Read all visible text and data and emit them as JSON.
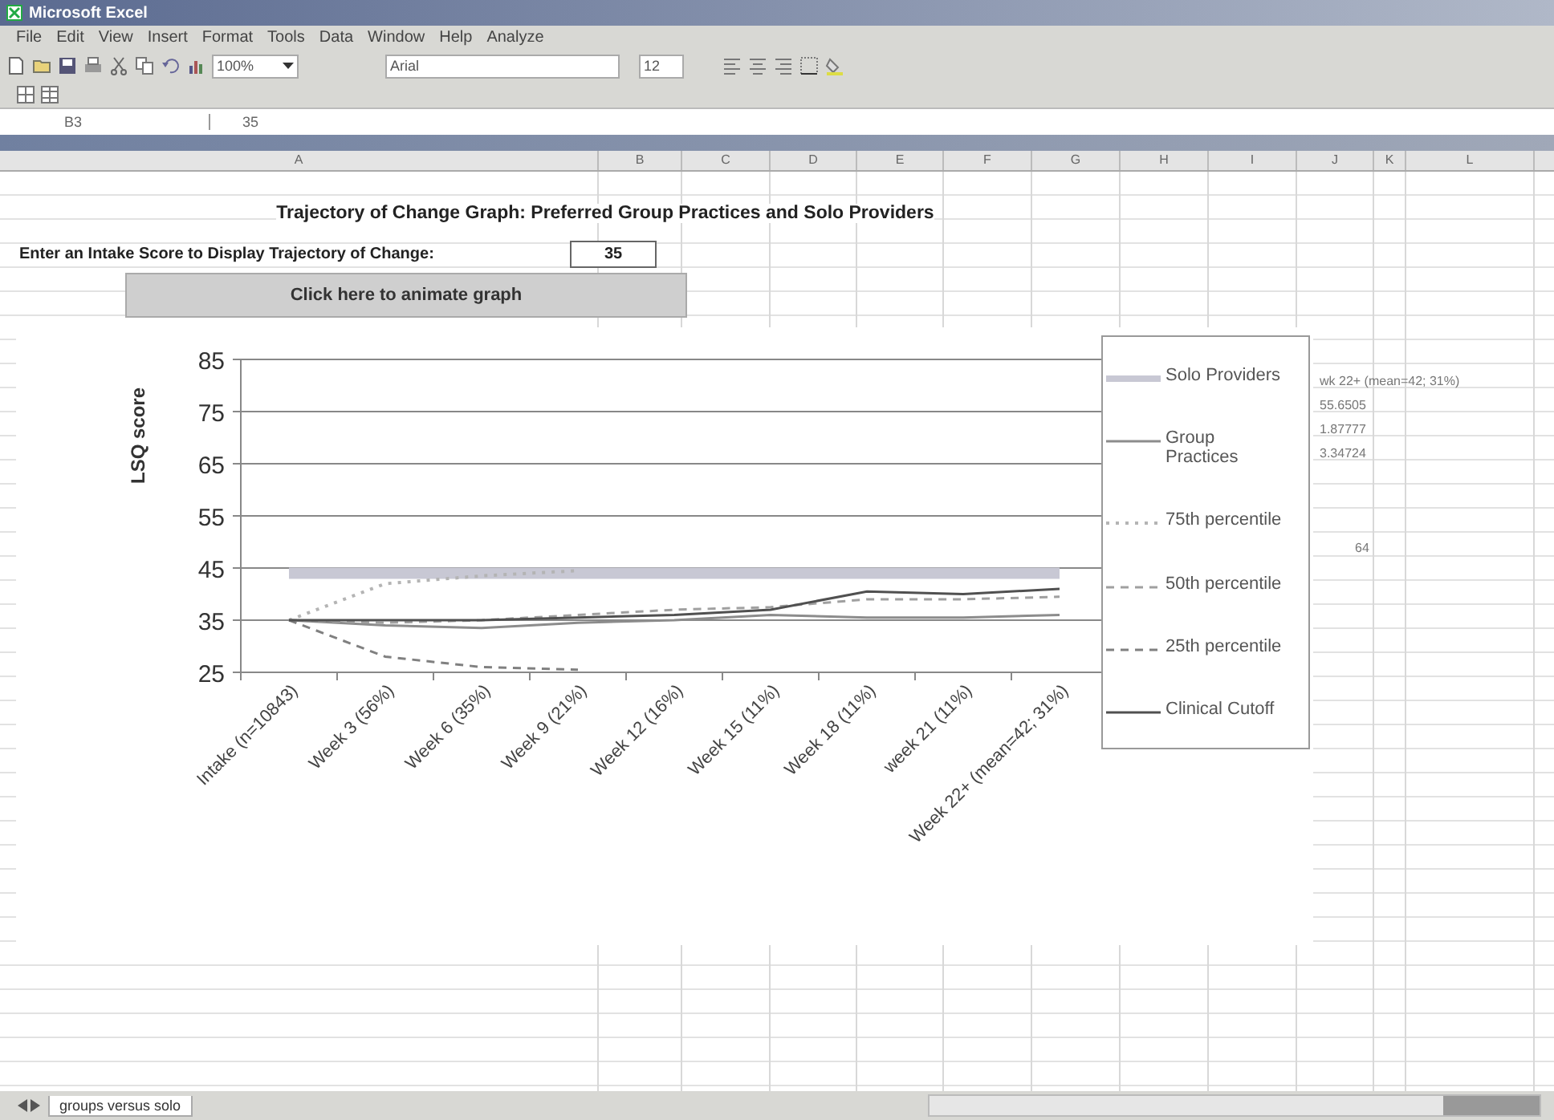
{
  "window": {
    "title": "Microsoft Excel"
  },
  "menu": [
    "File",
    "Edit",
    "View",
    "Insert",
    "Format",
    "Tools",
    "Data",
    "Window",
    "Help",
    "Analyze"
  ],
  "toolbar": {
    "zoom": "100%",
    "font": "Arial",
    "font_size": "12"
  },
  "formula_bar": {
    "name_box": "B3",
    "value": "35"
  },
  "columns": [
    "A",
    "B",
    "C",
    "D",
    "E",
    "F",
    "G",
    "H",
    "I",
    "J",
    "K",
    "L"
  ],
  "sheet": {
    "title": "Trajectory of Change Graph:  Preferred Group Practices and Solo Providers",
    "intake_label": "Enter an Intake Score to Display Trajectory of Change:",
    "intake_value": "35",
    "animate_button": "Click here to animate graph",
    "side_cells": [
      "wk 22+ (mean=42; 31%)",
      "55.6505",
      "1.87777",
      "3.34724",
      "64"
    ]
  },
  "chart": {
    "chart_data": {
      "type": "line",
      "ylabel": "LSQ score",
      "categories": [
        "Intake (n=10843)",
        "Week 3 (56%)",
        "Week 6 (35%)",
        "Week 9 (21%)",
        "Week 12 (16%)",
        "Week 15 (11%)",
        "Week 18 (11%)",
        "week 21 (11%)",
        "Week 22+ (mean=42; 31%)"
      ],
      "legend": true,
      "ylim": [
        25,
        85
      ],
      "yticks": [
        25,
        35,
        45,
        55,
        65,
        75,
        85
      ],
      "series": [
        {
          "name": "Solo Providers",
          "color": "#c8c8d4",
          "line_style": "solid",
          "values": [
            44,
            44,
            44,
            44,
            44,
            44,
            44,
            44,
            44
          ]
        },
        {
          "name": "Group Practices",
          "color": "#8c8c8c",
          "line_style": "solid",
          "values": [
            35,
            34,
            33.5,
            34.5,
            35,
            36,
            35.5,
            35.5,
            36
          ]
        },
        {
          "name": "75th percentile",
          "color": "#b4b4b4",
          "line_style": "dotted",
          "values": [
            35,
            42,
            43.5,
            44.5,
            null,
            null,
            null,
            null,
            null
          ]
        },
        {
          "name": "50th percentile",
          "color": "#a0a0a0",
          "line_style": "dashed",
          "values": [
            35,
            34.5,
            35,
            36,
            37,
            37.5,
            39,
            39,
            39.5
          ]
        },
        {
          "name": "25th percentile",
          "color": "#808080",
          "line_style": "dashed",
          "values": [
            35,
            28,
            26,
            25.5,
            null,
            null,
            null,
            null,
            null
          ]
        },
        {
          "name": "Clinical Cutoff",
          "color": "#505050",
          "line_style": "solid",
          "values": [
            35,
            35,
            35,
            35.5,
            36,
            37,
            40.5,
            40,
            41
          ]
        }
      ]
    }
  },
  "sheet_tabs": [
    {
      "label": "groups versus solo",
      "selected": true
    }
  ]
}
